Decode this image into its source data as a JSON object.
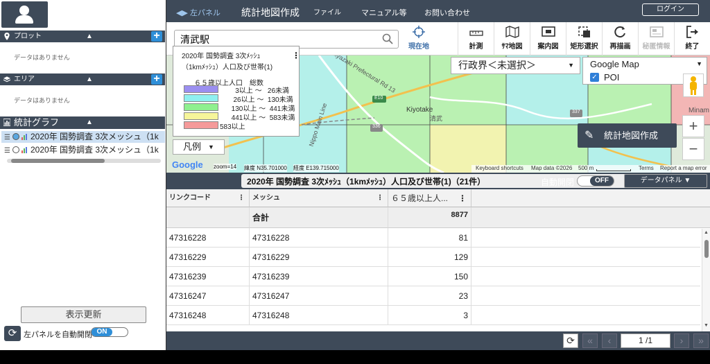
{
  "app": {
    "title": "統計地図作成",
    "left_panel_toggle": "左パネル"
  },
  "menu": {
    "file": "ファイル",
    "manual": "マニュアル等",
    "contact": "お問い合わせ",
    "login": "ログイン"
  },
  "sidebar": {
    "plot_title": "プロット",
    "plot_empty": "データはありません",
    "area_title": "エリア",
    "area_empty": "データはありません",
    "graph_title": "統計グラフ",
    "graphs": [
      {
        "label": "2020年 国勢調査 3次メッシュ（1k",
        "selected": true
      },
      {
        "label": "2020年 国勢調査 3次メッシュ（1k",
        "selected": false
      }
    ],
    "refresh_label": "表示更新",
    "auto_open_label": "左パネルを自動開閉",
    "auto_open_state": "ON"
  },
  "search": {
    "value": "清武駅",
    "placeholder": ""
  },
  "tools": [
    {
      "label": "現在地",
      "icon": "crosshair-icon"
    },
    {
      "label": "計測",
      "icon": "ruler-icon"
    },
    {
      "label": "ｻﾏ地図",
      "icon": "map-icon"
    },
    {
      "label": "案内図",
      "icon": "guide-map-icon"
    },
    {
      "label": "矩形選択",
      "icon": "rect-select-icon"
    },
    {
      "label": "再描画",
      "icon": "redraw-icon"
    },
    {
      "label": "秘匿情報",
      "icon": "secret-info-icon",
      "disabled": true
    },
    {
      "label": "終了",
      "icon": "exit-icon"
    }
  ],
  "legend": {
    "title_line1": "2020年 国勢調査 3次ﾒｯｼｭ",
    "title_line2": "（1kmﾒｯｼｭ）人口及び世帯(1)",
    "header": "６５歳以上人口　総数",
    "rows": [
      {
        "label": "        3以上 ～   26未満",
        "color": "#9b8ff0"
      },
      {
        "label": "       26以上 ～  130未満",
        "color": "#8ff0f0"
      },
      {
        "label": "      130以上 ～  441未満",
        "color": "#8ff08f"
      },
      {
        "label": "      441以上 ～  583未満",
        "color": "#f6f59a"
      },
      {
        "label": "583以上",
        "color": "#f59a9a"
      }
    ],
    "button": "凡例"
  },
  "map": {
    "admin_select": "行政界＜未選択＞",
    "basemap_select": "Google Map",
    "poi_label": "POI",
    "poi_checked": true,
    "stat_map_button": "統計地図作成",
    "zoom_text": "zoom=14",
    "lat_text": "緯度 N35.701000",
    "lon_text": "経度 E139.715000",
    "google": "Google",
    "attribution": [
      "Keyboard shortcuts",
      "Map data ©2026",
      "500 m",
      "Terms",
      "Report a map error"
    ],
    "labels": [
      "Miyazaki Prefectural Rd 13",
      "Kiyotake",
      "清武",
      "Nippo Main Line",
      "Minam"
    ],
    "road_shields": [
      "E10",
      "336",
      "337",
      "337"
    ]
  },
  "table": {
    "title": "2020年 国勢調査 3次ﾒｯｼｭ（1kmﾒｯｼｭ）人口及び世帯(1)（21件）",
    "auto_open_label": "自動開閉",
    "auto_open_state": "OFF",
    "data_panel_label": "データパネル",
    "columns": [
      "リンクコード",
      "メッシュ",
      "６５歳以上人..."
    ],
    "sum_label": "合計",
    "sum_value": "8877",
    "rows": [
      {
        "link": "47316228",
        "mesh": "47316228",
        "value": "81"
      },
      {
        "link": "47316229",
        "mesh": "47316229",
        "value": "129"
      },
      {
        "link": "47316239",
        "mesh": "47316239",
        "value": "150"
      },
      {
        "link": "47316247",
        "mesh": "47316247",
        "value": "23"
      },
      {
        "link": "47316248",
        "mesh": "47316248",
        "value": "3"
      }
    ]
  },
  "pager": {
    "page": "1 /1"
  }
}
